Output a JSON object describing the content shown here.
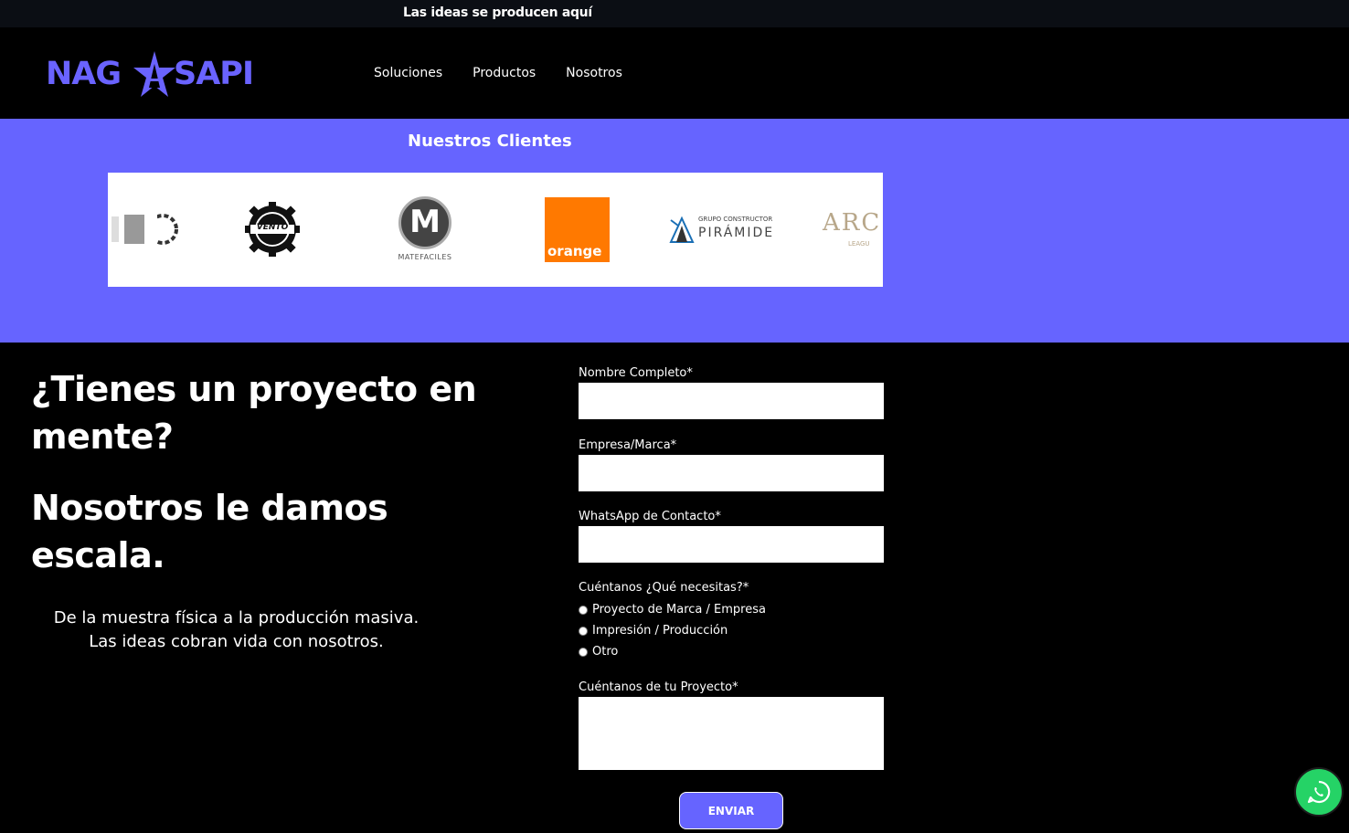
{
  "topbar": {
    "text": "Las ideas se producen aquí"
  },
  "header": {
    "logo_left": "NAG",
    "logo_right": "SAPI",
    "nav": [
      "Soluciones",
      "Productos",
      "Nosotros"
    ]
  },
  "clients": {
    "title": "Nuestros Clientes",
    "logos": [
      {
        "name": "partial-logo",
        "text": ""
      },
      {
        "name": "vento",
        "text": "VENTO"
      },
      {
        "name": "matefaciles",
        "text": "MATEFACILES",
        "mark": "M"
      },
      {
        "name": "orange",
        "text": "orange"
      },
      {
        "name": "grupo-constructor-piramide",
        "text": "PIRÁMIDE",
        "subtext": "GRUPO CONSTRUCTOR"
      },
      {
        "name": "arc",
        "text": "ARC",
        "subtext": "LEAGU"
      }
    ]
  },
  "hero": {
    "heading1": "¿Tienes un proyecto en mente?",
    "heading2": "Nosotros le damos escala.",
    "sub_line1": "De la muestra física a la producción masiva.",
    "sub_line2": "Las ideas cobran vida con nosotros."
  },
  "form": {
    "name_label": "Nombre Completo*",
    "company_label": "Empresa/Marca*",
    "whatsapp_label": "WhatsApp de Contacto*",
    "needs_label": "Cuéntanos ¿Qué necesitas?*",
    "options": [
      "Proyecto de Marca / Empresa",
      "Impresión / Producción",
      "Otro"
    ],
    "project_label": "Cuéntanos de tu Proyecto*",
    "submit_label": "ENVIAR"
  },
  "colors": {
    "brand": "#6664ff",
    "logo": "#6a63ff",
    "orange": "#ff7900",
    "whatsapp": "#25d366"
  }
}
